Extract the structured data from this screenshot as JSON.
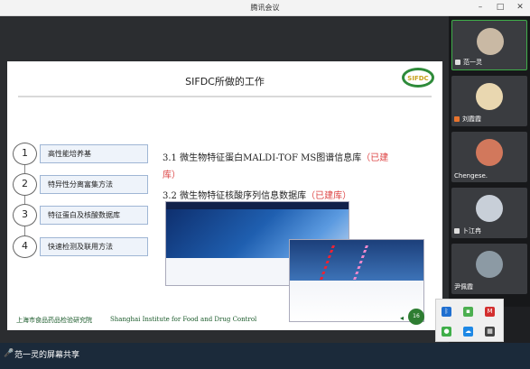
{
  "window": {
    "title": "腾讯会议"
  },
  "slide": {
    "title": "SIFDC所做的工作",
    "logo_text": "SIFDC",
    "steps": [
      {
        "num": "1",
        "label": "高性能培养基"
      },
      {
        "num": "2",
        "label": "特异性分离富集方法"
      },
      {
        "num": "3",
        "label": "特征蛋白及核酸数据库"
      },
      {
        "num": "4",
        "label": "快速检测及联用方法"
      }
    ],
    "line1_main": "3.1 微生物特征蛋白MALDI-TOF MS图谱信息库",
    "line1_tag": "（已建",
    "line1_cont": "库）",
    "line2_main": "3.2 微生物特征核酸序列信息数据库",
    "line2_tag": "（已建库）",
    "footer_cn": "上海市食品药品检验研究院",
    "footer_en": "Shanghai Institute for Food and Drug Control",
    "page": "16"
  },
  "participants": [
    {
      "name": "范一灵"
    },
    {
      "name": "刘霞霞"
    },
    {
      "name": "Chengese."
    },
    {
      "name": "卜江冉"
    },
    {
      "name": "尹佩霞"
    }
  ],
  "sharebar": {
    "text": "范一灵的屏幕共享"
  },
  "colors": {
    "accent_green": "#3fae49",
    "highlight_red": "#d44"
  }
}
